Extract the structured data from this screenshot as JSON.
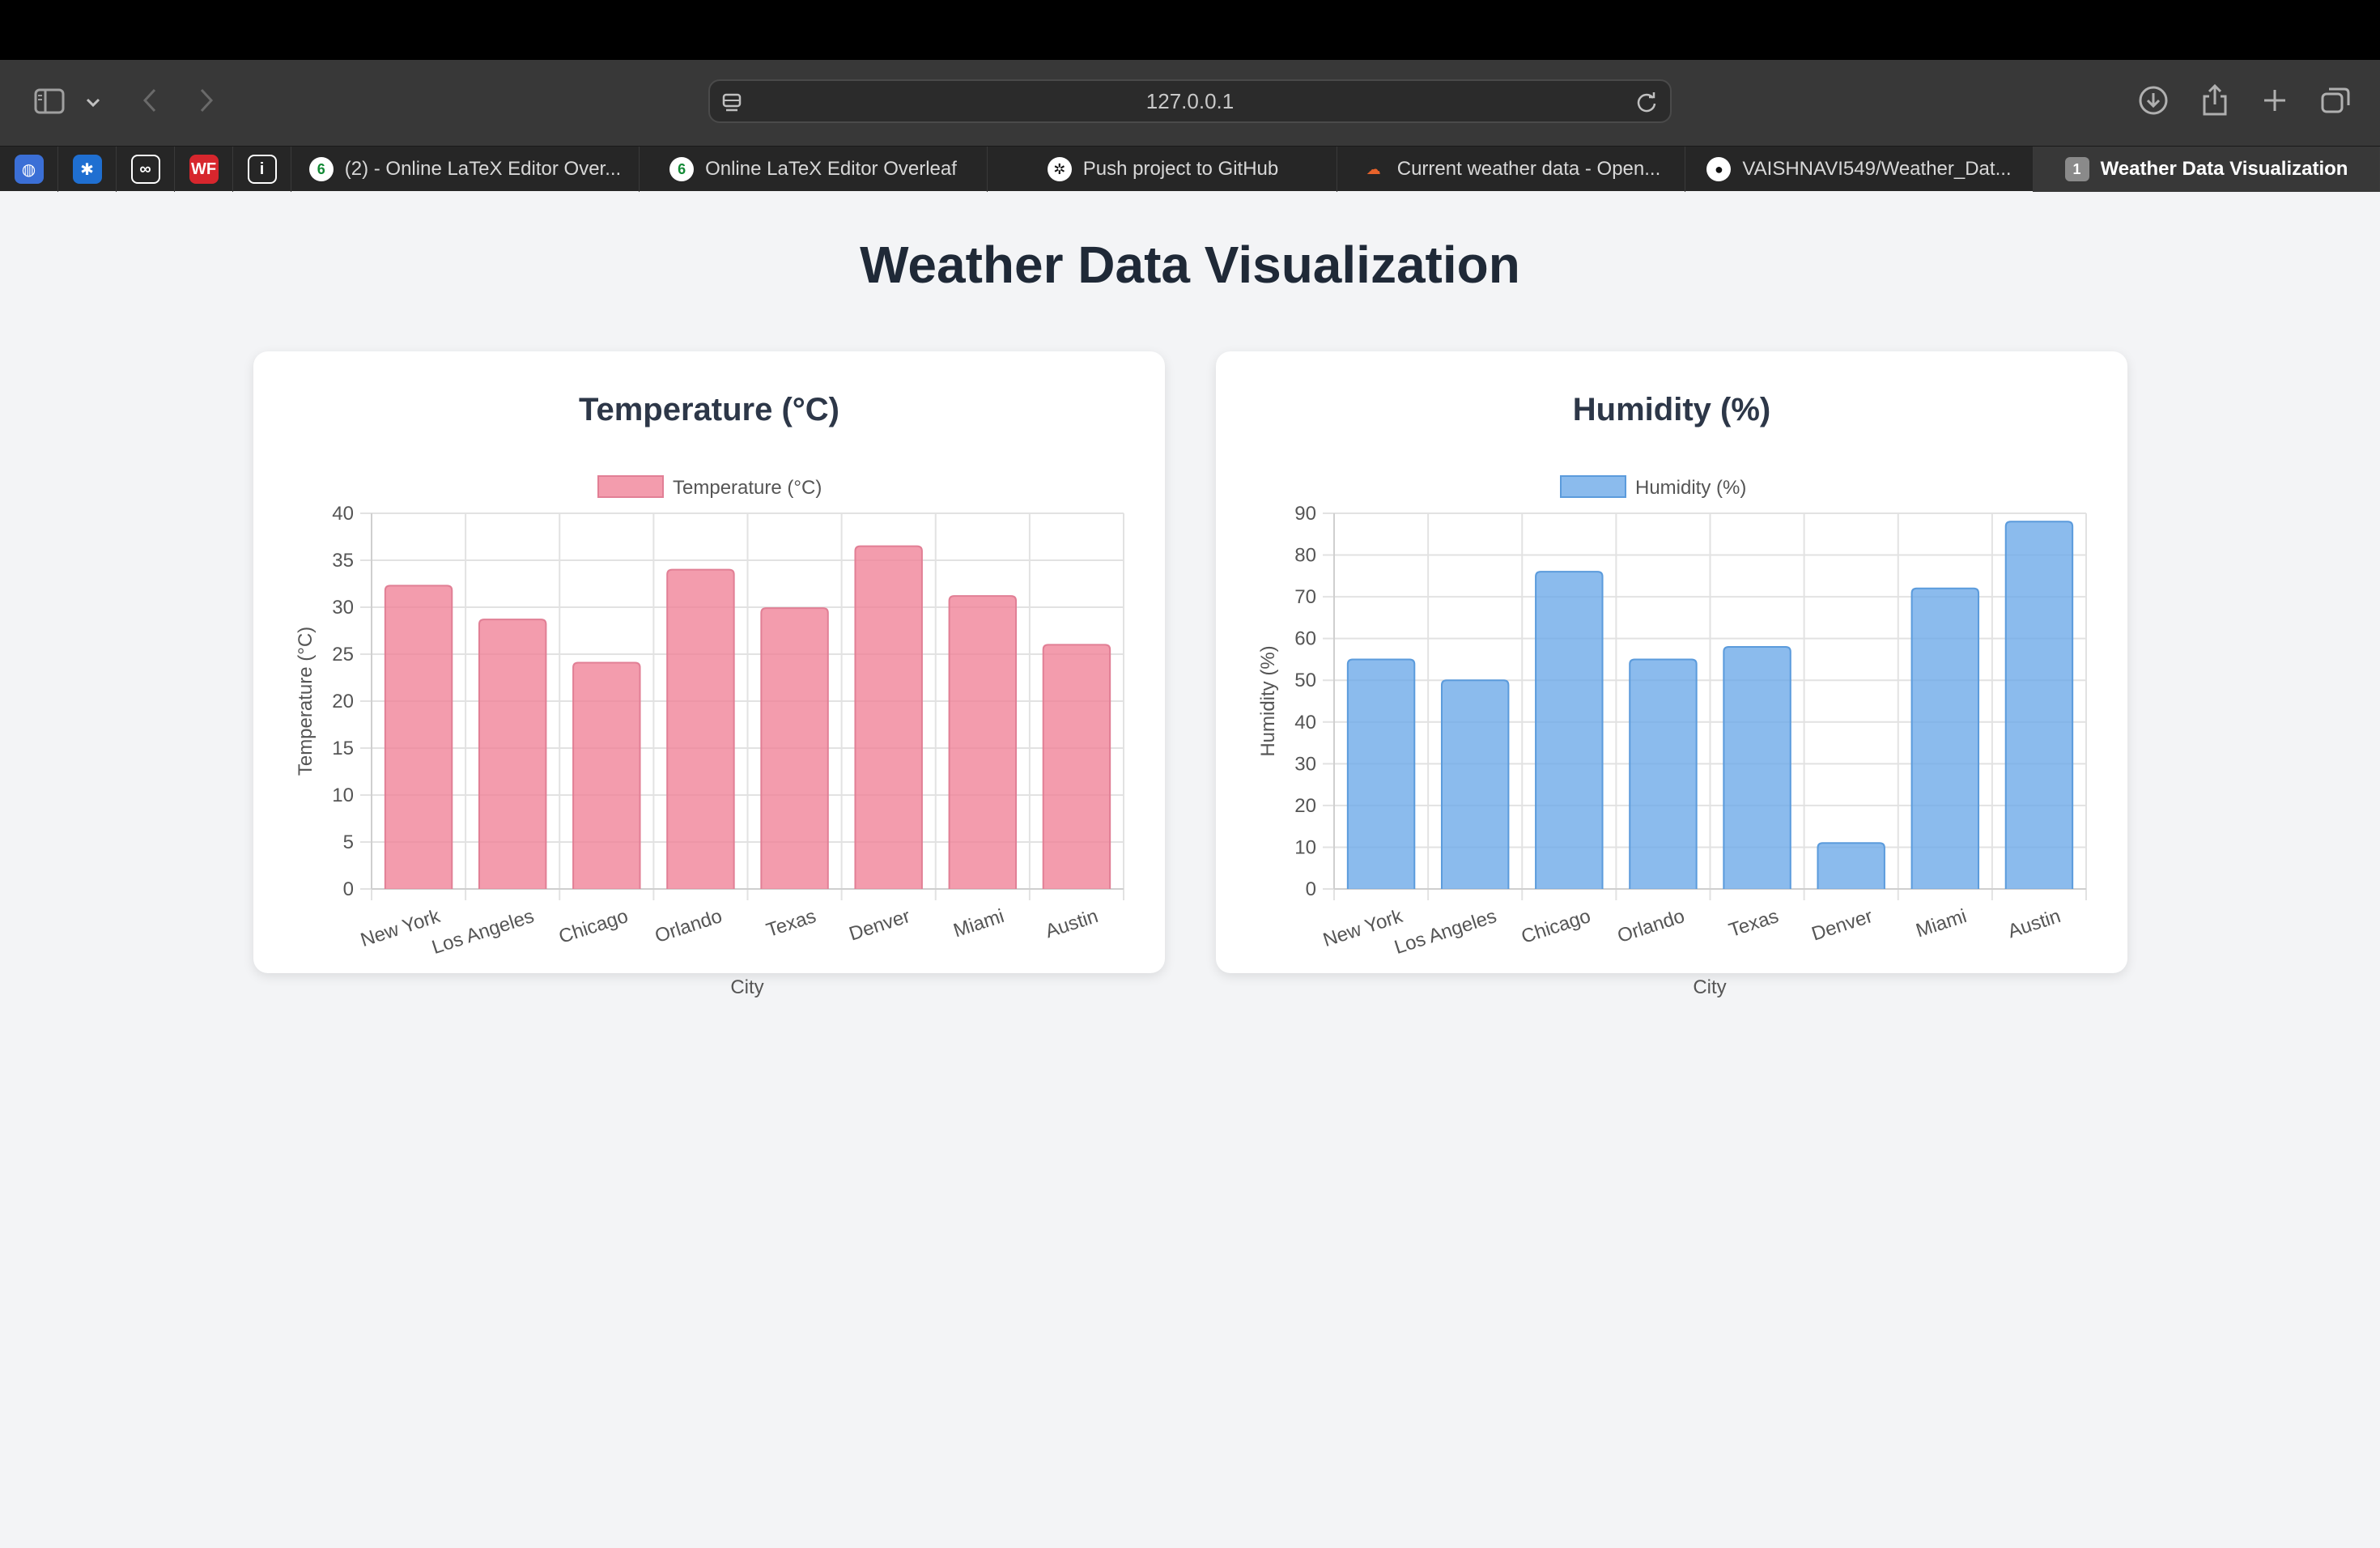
{
  "browser": {
    "url": "127.0.0.1",
    "pinned_tabs": [
      {
        "icon": "globe-icon",
        "color": "#3b6fd6",
        "glyph": "◍"
      },
      {
        "icon": "walmart-icon",
        "color": "#1f6fd1",
        "glyph": "✱"
      },
      {
        "icon": "meta-icon",
        "color": "#ffffff",
        "glyph": "∞"
      },
      {
        "icon": "wf-icon",
        "color": "#d7262d",
        "glyph": "WF"
      },
      {
        "icon": "info-icon",
        "color": "#ffffff",
        "glyph": "i"
      }
    ],
    "tabs": [
      {
        "label": "(2) - Online LaTeX Editor Over...",
        "icon": "overleaf-icon",
        "glyph": "6"
      },
      {
        "label": "Online LaTeX Editor Overleaf",
        "icon": "overleaf-icon",
        "glyph": "6"
      },
      {
        "label": "Push project to GitHub",
        "icon": "openai-icon",
        "glyph": "✲"
      },
      {
        "label": "Current weather data - Open...",
        "icon": "openweather-icon",
        "glyph": "☁"
      },
      {
        "label": "VAISHNAVI549/Weather_Dat...",
        "icon": "github-icon",
        "glyph": "●"
      },
      {
        "label": "Weather Data Visualization",
        "icon": "tab-badge-icon",
        "glyph": "1",
        "active": true
      }
    ]
  },
  "page": {
    "title": "Weather Data Visualization"
  },
  "chart_data": [
    {
      "type": "bar",
      "title": "Temperature (°C)",
      "categories": [
        "New York",
        "Los Angeles",
        "Chicago",
        "Orlando",
        "Texas",
        "Denver",
        "Miami",
        "Austin"
      ],
      "series": [
        {
          "name": "Temperature (°C)",
          "values": [
            32.3,
            28.7,
            24.1,
            34.0,
            29.9,
            36.5,
            31.2,
            26.0
          ]
        }
      ],
      "xlabel": "City",
      "ylabel": "Temperature (°C)",
      "ylim": [
        0,
        40
      ],
      "yticks": [
        0,
        5,
        10,
        15,
        20,
        25,
        30,
        35,
        40
      ],
      "grid": true,
      "legend": "top-center",
      "fill_color": "rgba(240,128,150,0.78)",
      "border_color": "#e17f95"
    },
    {
      "type": "bar",
      "title": "Humidity (%)",
      "categories": [
        "New York",
        "Los Angeles",
        "Chicago",
        "Orlando",
        "Texas",
        "Denver",
        "Miami",
        "Austin"
      ],
      "series": [
        {
          "name": "Humidity (%)",
          "values": [
            55,
            50,
            76,
            55,
            58,
            11,
            72,
            88
          ]
        }
      ],
      "xlabel": "City",
      "ylabel": "Humidity (%)",
      "ylim": [
        0,
        90
      ],
      "yticks": [
        0,
        10,
        20,
        30,
        40,
        50,
        60,
        70,
        80,
        90
      ],
      "grid": true,
      "legend": "top-center",
      "fill_color": "rgba(110,170,232,0.80)",
      "border_color": "#5b9bdc"
    }
  ]
}
